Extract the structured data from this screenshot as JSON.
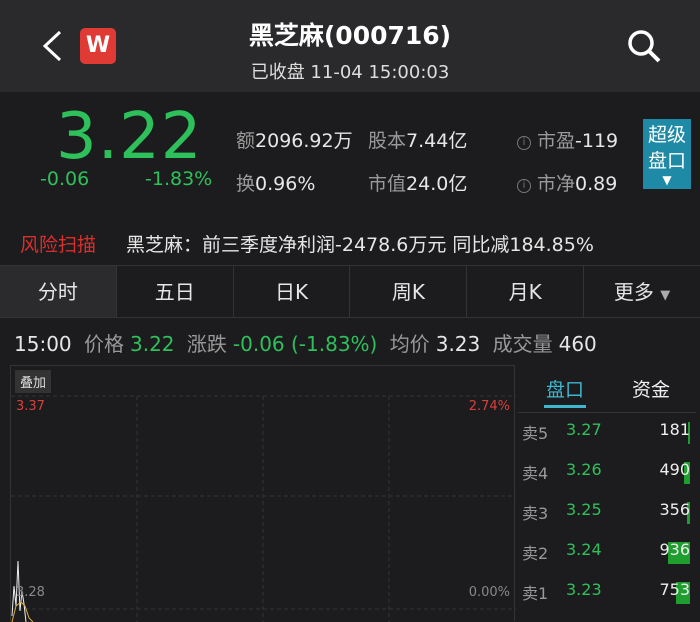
{
  "header": {
    "title": "黑芝麻(000716)",
    "subtitle": "已收盘 11-04 15:00:03",
    "logo": "W"
  },
  "quote": {
    "price": "3.22",
    "change": "-0.06",
    "change_pct": "-1.83%",
    "amount_label": "额",
    "amount": "2096.92万",
    "capital_label": "股本",
    "capital": "7.44亿",
    "pe_label": "市盈",
    "pe": "-119",
    "turnover_label": "换",
    "turnover": "0.96%",
    "mktcap_label": "市值",
    "mktcap": "24.0亿",
    "pb_label": "市净",
    "pb": "0.89",
    "info_icon": "i",
    "super_line1": "超级",
    "super_line2": "盘口"
  },
  "risk": {
    "label": "风险扫描",
    "text": "黑芝麻：前三季度净利润-2478.6万元 同比减184.85%"
  },
  "tabs": [
    "分时",
    "五日",
    "日K",
    "周K",
    "月K",
    "更多"
  ],
  "tick": {
    "time": "15:00",
    "price_label": "价格",
    "price": "3.22",
    "chg_label": "涨跌",
    "chg": "-0.06 (-1.83%)",
    "avg_label": "均价",
    "avg": "3.23",
    "vol_label": "成交量",
    "vol": "460"
  },
  "chart": {
    "overlay": "叠加",
    "top_price": "3.37",
    "top_pct": "2.74%",
    "mid_price": "3.28",
    "mid_pct": "0.00%"
  },
  "panel": {
    "tabs": [
      "盘口",
      "资金"
    ],
    "asks": [
      {
        "label": "卖5",
        "price": "3.27",
        "vol": 181
      },
      {
        "label": "卖4",
        "price": "3.26",
        "vol": 490
      },
      {
        "label": "卖3",
        "price": "3.25",
        "vol": 356
      },
      {
        "label": "卖2",
        "price": "3.24",
        "vol": 936
      },
      {
        "label": "卖1",
        "price": "3.23",
        "vol": 753
      }
    ]
  },
  "colors": {
    "down": "#2ec05a",
    "up": "#e0403a",
    "accent": "#1e8aa6"
  }
}
